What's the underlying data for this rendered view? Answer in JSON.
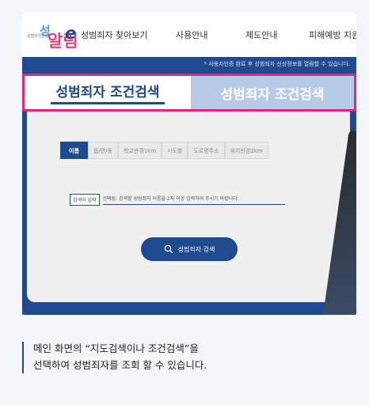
{
  "logo": {
    "small_text": "성범죄자알림",
    "mark_a": "성",
    "mark_b": "알림",
    "mark_c": "e"
  },
  "nav": {
    "items": [
      "성범죄자 찾아보기",
      "사용안내",
      "제도안내",
      "피해예방 지원"
    ]
  },
  "notice": "* 사용자인증 완료 후 성범죄자 신상정보를 열람할 수 있습니다.",
  "tabs": [
    {
      "label": "성범죄자 조건검색"
    },
    {
      "label": "성범죄자 조건검색"
    }
  ],
  "filters": [
    "이름",
    "읍/면/동",
    "학교반경1km",
    "시도별",
    "도로명주소",
    "위치반경2km"
  ],
  "hint": {
    "tag": "검색어 입력",
    "text": "선택됨: 검색할 성범죄자 이름을 2자 이상 입력하여 주시기 바랍니다."
  },
  "search_button": {
    "label": "성범죄자 검색"
  },
  "caption": {
    "line1": "메인 화면의 “지도검색이나 조건검색”을",
    "line2": "선택하여 성범죄자를 조회 할 수 있습니다."
  },
  "colors": {
    "brand": "#1f4a8f",
    "highlight": "#e8237f",
    "inactive_tab": "#b7cbe9"
  }
}
